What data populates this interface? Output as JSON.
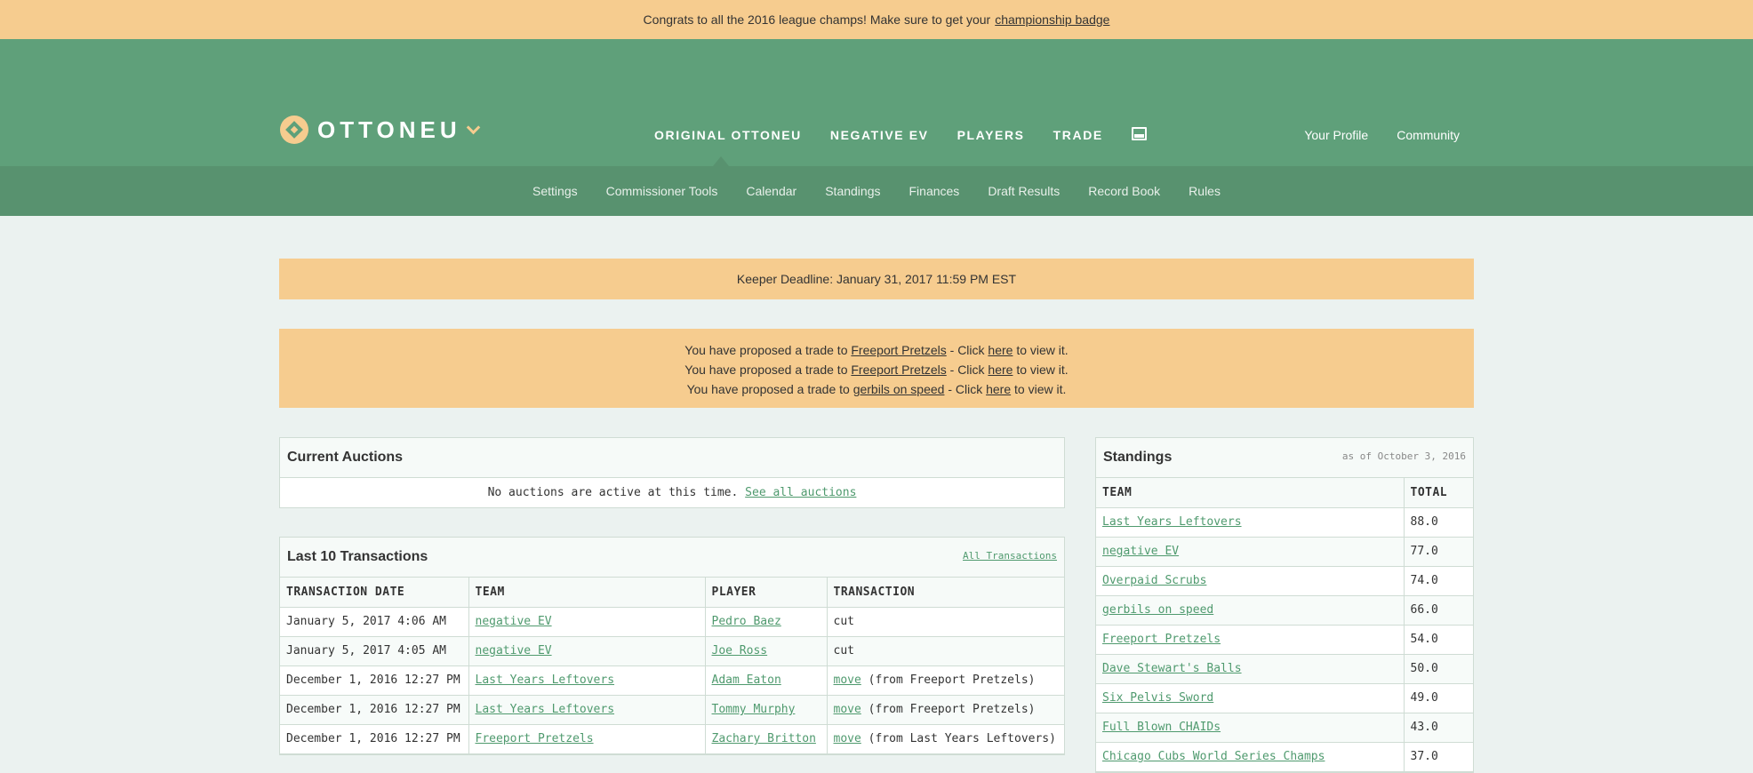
{
  "announcement": {
    "text": "Congrats to all the 2016 league champs! Make sure to get your",
    "link": "championship badge"
  },
  "header": {
    "logo_text": "OTTONEU",
    "main_nav": [
      "ORIGINAL OTTONEU",
      "NEGATIVE EV",
      "PLAYERS",
      "TRADE"
    ],
    "user_nav": [
      "Your Profile",
      "Community"
    ]
  },
  "sub_nav": [
    "Settings",
    "Commissioner Tools",
    "Calendar",
    "Standings",
    "Finances",
    "Draft Results",
    "Record Book",
    "Rules"
  ],
  "keeper_deadline": "Keeper Deadline: January 31, 2017 11:59 PM EST",
  "trades": [
    {
      "prefix": "You have proposed a trade to",
      "team": "Freeport Pretzels",
      "mid": "- Click",
      "link": "here",
      "suffix": "to view it."
    },
    {
      "prefix": "You have proposed a trade to",
      "team": "Freeport Pretzels",
      "mid": "- Click",
      "link": "here",
      "suffix": "to view it."
    },
    {
      "prefix": "You have proposed a trade to",
      "team": "gerbils on speed",
      "mid": "- Click",
      "link": "here",
      "suffix": "to view it."
    }
  ],
  "auctions": {
    "title": "Current Auctions",
    "empty_text": "No auctions are active at this time.",
    "link": "See all auctions"
  },
  "transactions": {
    "title": "Last 10 Transactions",
    "all_link": "All Transactions",
    "columns": [
      "TRANSACTION DATE",
      "TEAM",
      "PLAYER",
      "TRANSACTION"
    ],
    "rows": [
      {
        "date": "January 5, 2017 4:06 AM",
        "team": "negative EV",
        "player": "Pedro Baez",
        "action": "cut",
        "detail": ""
      },
      {
        "date": "January 5, 2017 4:05 AM",
        "team": "negative EV",
        "player": "Joe Ross",
        "action": "cut",
        "detail": ""
      },
      {
        "date": "December 1, 2016 12:27 PM",
        "team": "Last Years Leftovers",
        "player": "Adam Eaton",
        "action": "move",
        "detail": "(from Freeport Pretzels)"
      },
      {
        "date": "December 1, 2016 12:27 PM",
        "team": "Last Years Leftovers",
        "player": "Tommy Murphy",
        "action": "move",
        "detail": "(from Freeport Pretzels)"
      },
      {
        "date": "December 1, 2016 12:27 PM",
        "team": "Freeport Pretzels",
        "player": "Zachary Britton",
        "action": "move",
        "detail": "(from Last Years Leftovers)"
      }
    ]
  },
  "standings": {
    "title": "Standings",
    "as_of": "as of October 3, 2016",
    "columns": [
      "TEAM",
      "TOTAL"
    ],
    "rows": [
      {
        "team": "Last Years Leftovers",
        "total": "88.0"
      },
      {
        "team": "negative EV",
        "total": "77.0"
      },
      {
        "team": "Overpaid Scrubs",
        "total": "74.0"
      },
      {
        "team": "gerbils on speed",
        "total": "66.0"
      },
      {
        "team": "Freeport Pretzels",
        "total": "54.0"
      },
      {
        "team": "Dave Stewart's Balls",
        "total": "50.0"
      },
      {
        "team": "Six Pelvis Sword",
        "total": "49.0"
      },
      {
        "team": "Full Blown CHAIDs",
        "total": "43.0"
      },
      {
        "team": "Chicago Cubs World Series Champs",
        "total": "37.0"
      }
    ]
  }
}
